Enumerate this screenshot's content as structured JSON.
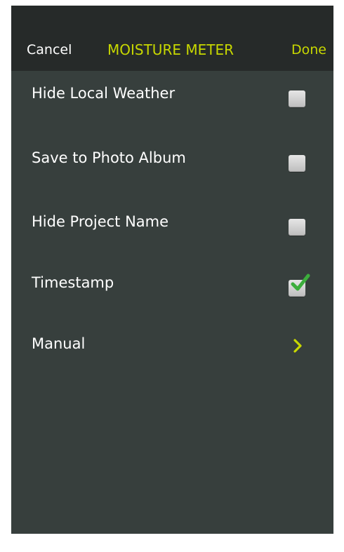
{
  "nav": {
    "cancel_label": "Cancel",
    "title": "MOISTURE METER",
    "done_label": "Done"
  },
  "settings": [
    {
      "label": "Hide Local Weather",
      "control": "checkbox",
      "checked": false
    },
    {
      "label": "Save to Photo Album",
      "control": "checkbox",
      "checked": false
    },
    {
      "label": "Hide Project Name",
      "control": "checkbox",
      "checked": false
    },
    {
      "label": "Timestamp",
      "control": "checkbox",
      "checked": true
    },
    {
      "label": "Manual",
      "control": "disclosure"
    }
  ],
  "colors": {
    "accent": "#c8d800",
    "background": "#373f3d",
    "bar": "#262a29",
    "check": "#3cae3c"
  },
  "icons": {
    "checkmark": "checkmark-icon",
    "disclosure": "chevron-right-icon"
  }
}
